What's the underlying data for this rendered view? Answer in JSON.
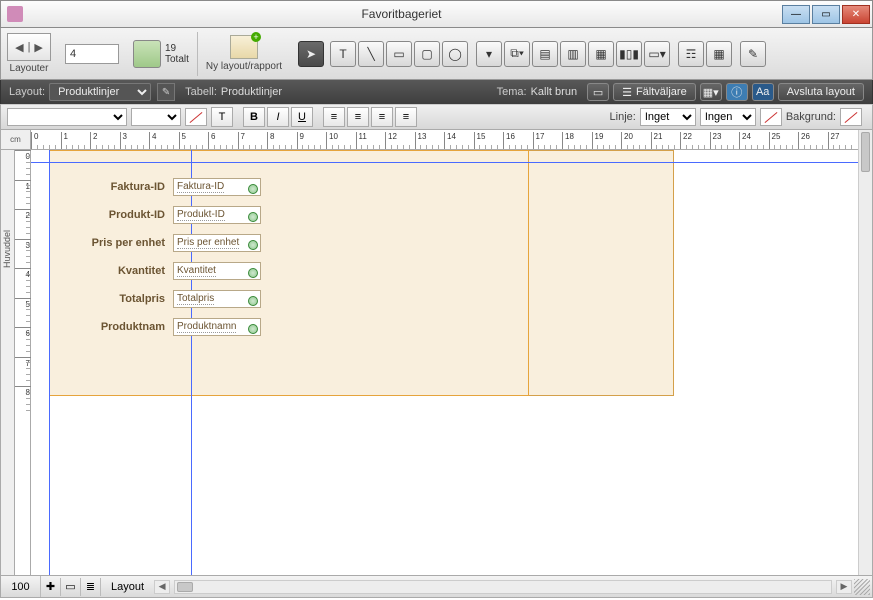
{
  "window": {
    "title": "Favoritbageriet"
  },
  "toolbar1": {
    "layouter_label": "Layouter",
    "page_number": "4",
    "total_count": "19",
    "total_label": "Totalt",
    "new_layout_label": "Ny layout/rapport"
  },
  "darkbar": {
    "layout_label": "Layout:",
    "layout_value": "Produktlinjer",
    "table_label": "Tabell:",
    "table_value": "Produktlinjer",
    "theme_label": "Tema:",
    "theme_value": "Kallt brun",
    "fieldpicker": "Fältväljare",
    "exit": "Avsluta layout"
  },
  "fmtbar": {
    "line_label": "Linje:",
    "line_value": "Inget",
    "line_style": "Ingen",
    "bg_label": "Bakgrund:"
  },
  "rulers": {
    "unit": "cm",
    "h_labels": [
      "0",
      "1",
      "2",
      "3",
      "4",
      "5",
      "6",
      "7",
      "8",
      "9",
      "10",
      "11",
      "12",
      "13",
      "14",
      "15",
      "16",
      "17",
      "18",
      "19",
      "20",
      "21",
      "22",
      "23",
      "24",
      "25",
      "26",
      "27"
    ],
    "v_labels": [
      "0",
      "1",
      "2",
      "3",
      "4",
      "5",
      "6",
      "7",
      "8"
    ],
    "part_label": "Huvuddel"
  },
  "fields": [
    {
      "label": "Faktura-ID",
      "value": "Faktura-ID"
    },
    {
      "label": "Produkt-ID",
      "value": "Produkt-ID"
    },
    {
      "label": "Pris per enhet",
      "value": "Pris per enhet"
    },
    {
      "label": "Kvantitet",
      "value": "Kvantitet"
    },
    {
      "label": "Totalpris",
      "value": "Totalpris"
    },
    {
      "label": "Produktnam",
      "value": "Produktnamn"
    }
  ],
  "statusbar": {
    "zoom": "100",
    "mode": "Layout"
  }
}
